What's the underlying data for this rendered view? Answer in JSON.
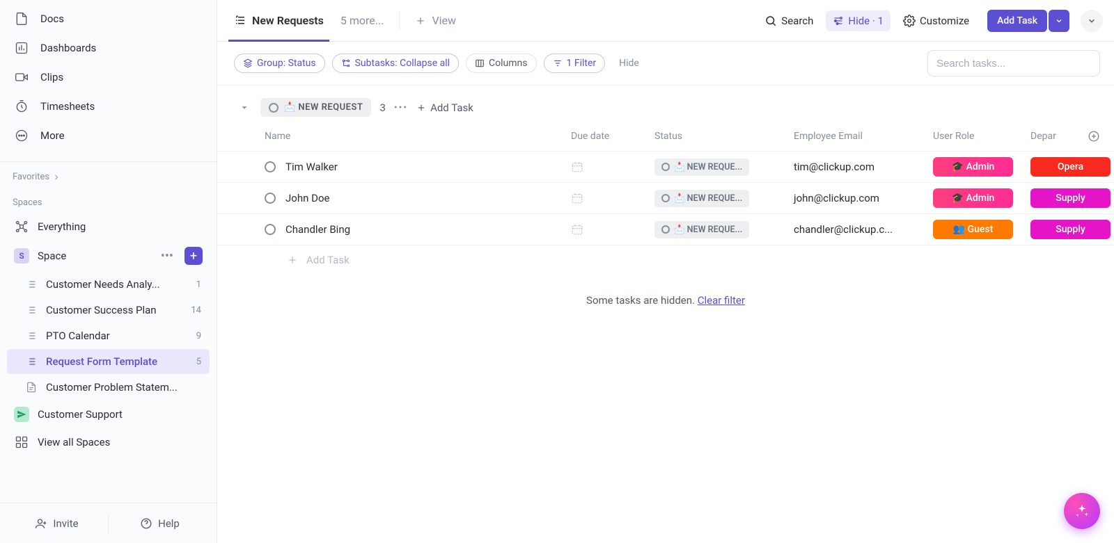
{
  "sidebar": {
    "nav": [
      {
        "label": "Docs"
      },
      {
        "label": "Dashboards"
      },
      {
        "label": "Clips"
      },
      {
        "label": "Timesheets"
      },
      {
        "label": "More"
      }
    ],
    "favorites_label": "Favorites",
    "spaces_label": "Spaces",
    "everything_label": "Everything",
    "space": {
      "initial": "S",
      "name": "Space",
      "lists": [
        {
          "label": "Customer Needs Analy...",
          "count": "1"
        },
        {
          "label": "Customer Success Plan",
          "count": "14"
        },
        {
          "label": "PTO Calendar",
          "count": "9"
        },
        {
          "label": "Request Form Template",
          "count": "5",
          "active": true
        },
        {
          "label": "Customer Problem Statem...",
          "count": ""
        }
      ]
    },
    "customer_support_label": "Customer Support",
    "view_all_spaces_label": "View all Spaces",
    "invite_label": "Invite",
    "help_label": "Help"
  },
  "toolbar": {
    "tabs": {
      "new_requests": "New Requests",
      "more": "5 more...",
      "view": "View"
    },
    "search_label": "Search",
    "hide_label": "Hide · 1",
    "customize_label": "Customize",
    "add_task_label": "Add Task"
  },
  "filters": {
    "group": "Group: Status",
    "subtasks": "Subtasks: Collapse all",
    "columns": "Columns",
    "filter": "1 Filter",
    "hide": "Hide",
    "search_placeholder": "Search tasks..."
  },
  "group": {
    "status_label": "📩 NEW REQUEST",
    "count": "3",
    "add_task_label": "Add Task"
  },
  "columns": {
    "name": "Name",
    "due": "Due date",
    "status": "Status",
    "email": "Employee Email",
    "role": "User Role",
    "dept": "Depar"
  },
  "rows": [
    {
      "name": "Tim Walker",
      "status": "📩 NEW REQUE...",
      "email": "tim@clickup.com",
      "role": "Admin",
      "role_icon": "🎓",
      "role_class": "admin",
      "dept": "Opera",
      "dept_class": "red"
    },
    {
      "name": "John Doe",
      "status": "📩 NEW REQUE...",
      "email": "john@clickup.com",
      "role": "Admin",
      "role_icon": "🎓",
      "role_class": "admin",
      "dept": "Supply",
      "dept_class": "magenta"
    },
    {
      "name": "Chandler Bing",
      "status": "📩 NEW REQUE...",
      "email": "chandler@clickup.c...",
      "role": "Guest",
      "role_icon": "👥",
      "role_class": "guest",
      "dept": "Supply",
      "dept_class": "magenta"
    }
  ],
  "bottom": {
    "add_task": "Add Task",
    "hidden_msg": "Some tasks are hidden. ",
    "clear_filter": "Clear filter"
  }
}
